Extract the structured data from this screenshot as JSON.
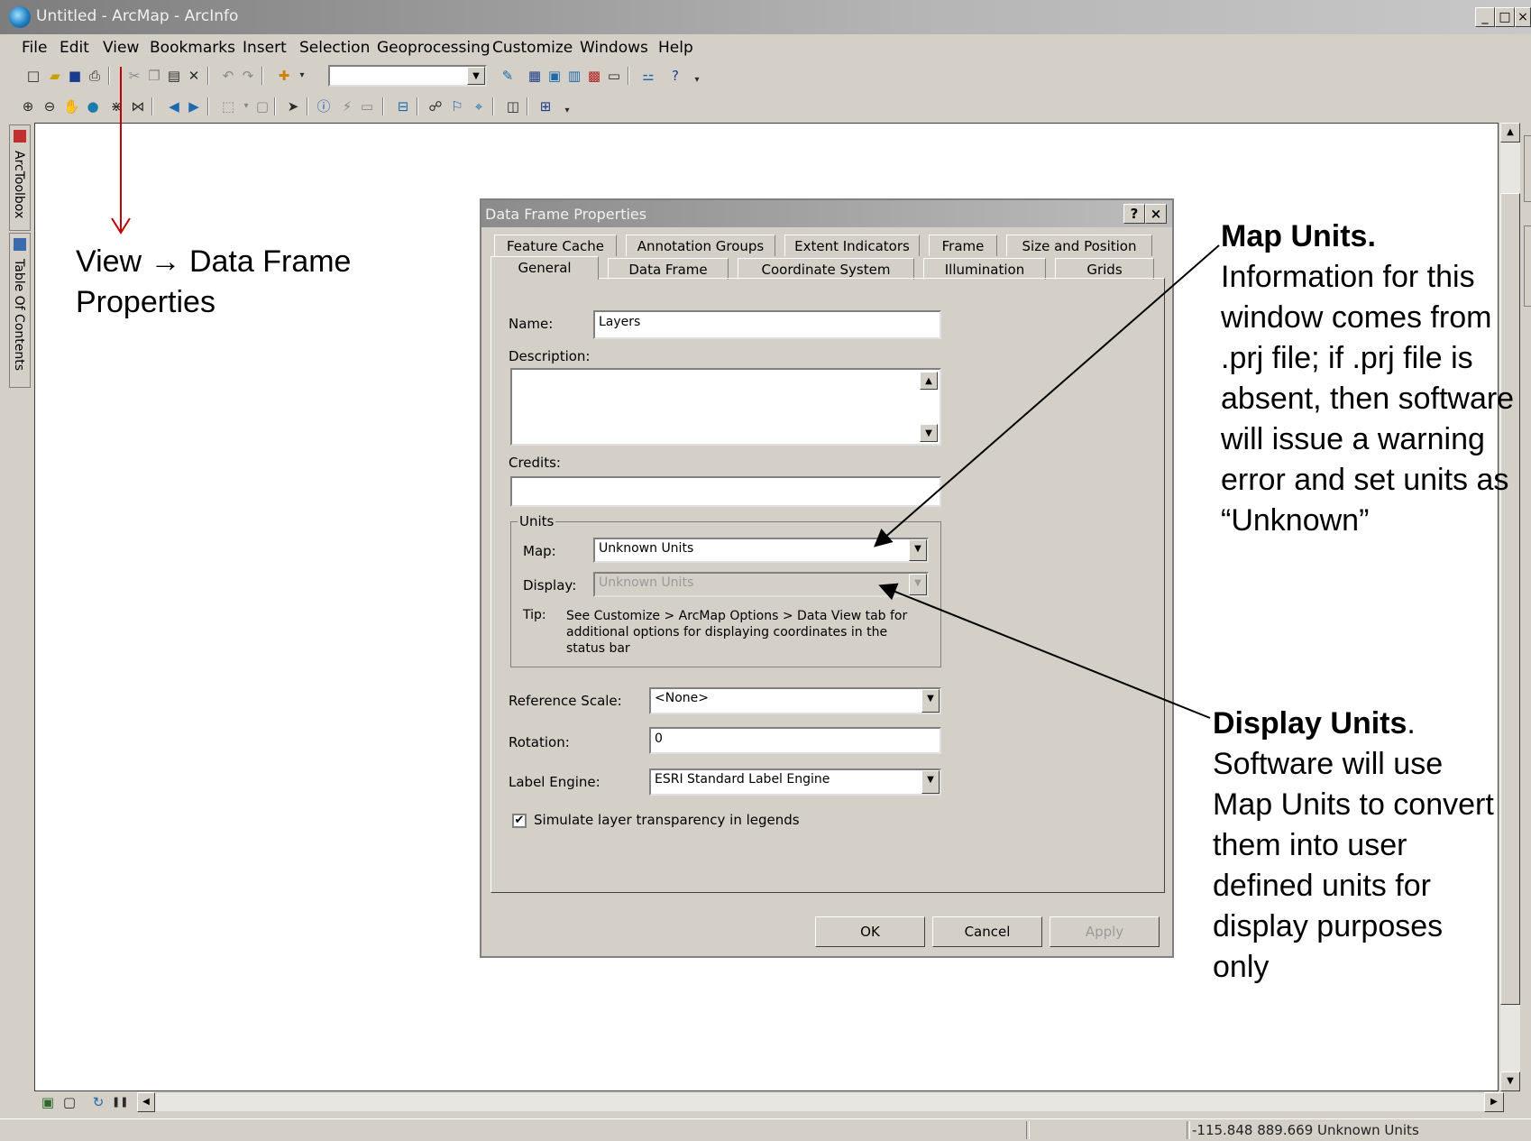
{
  "window": {
    "title": "Untitled - ArcMap - ArcInfo",
    "controls": {
      "minimize": "_",
      "maximize": "□",
      "close": "×"
    }
  },
  "menu": [
    "File",
    "Edit",
    "View",
    "Bookmarks",
    "Insert",
    "Selection",
    "Geoprocessing",
    "Customize",
    "Windows",
    "Help"
  ],
  "side_panels": [
    "ArcToolbox",
    "Table Of Contents"
  ],
  "annotations": {
    "view_path": "View → Data Frame Properties",
    "map_units_title": "Map Units.",
    "map_units_body": "Information for this window comes from .prj file; if .prj file is absent, then software will issue a warning error and set units as “Unknown”",
    "display_units_title": "Display Units",
    "display_units_dot": ".",
    "display_units_body": "Software will use Map Units to convert them into user defined units for display purposes only"
  },
  "dialog": {
    "title": "Data Frame Properties",
    "help_btn": "?",
    "close_btn": "×",
    "tabs_row1": [
      "Feature Cache",
      "Annotation Groups",
      "Extent Indicators",
      "Frame",
      "Size and Position"
    ],
    "tabs_row2": [
      "General",
      "Data Frame",
      "Coordinate System",
      "Illumination",
      "Grids"
    ],
    "active_tab": "General",
    "name_label": "Name:",
    "name_value": "Layers",
    "description_label": "Description:",
    "credits_label": "Credits:",
    "units_group": "Units",
    "map_label": "Map:",
    "map_value": "Unknown Units",
    "display_label": "Display:",
    "display_value": "Unknown Units",
    "tip_label": "Tip:",
    "tip_text": "See Customize > ArcMap Options > Data View tab for additional options for displaying coordinates in the status bar",
    "reference_scale_label": "Reference Scale:",
    "reference_scale_value": "<None>",
    "rotation_label": "Rotation:",
    "rotation_value": "0",
    "label_engine_label": "Label Engine:",
    "label_engine_value": "ESRI Standard Label Engine",
    "simulate_checkbox_label": "Simulate layer transparency in legends",
    "simulate_checked": true,
    "ok": "OK",
    "cancel": "Cancel",
    "apply": "Apply"
  },
  "status": {
    "coordinates": "-115.848  889.669 Unknown Units"
  },
  "colors": {
    "arrow_view": "#c00000",
    "annotation_text": "#000000",
    "dialog_bg": "#d4d0c8"
  }
}
